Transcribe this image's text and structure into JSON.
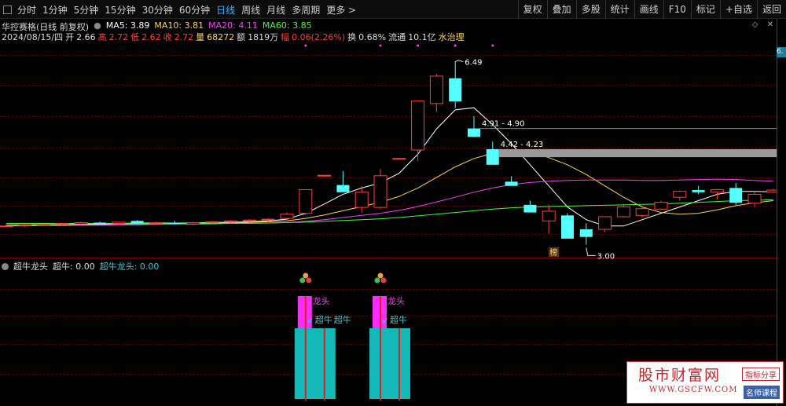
{
  "toolbar": {
    "periods": [
      "分时",
      "1分钟",
      "5分钟",
      "15分钟",
      "30分钟",
      "60分钟",
      "日线",
      "周线",
      "月线",
      "多周期",
      "更多"
    ],
    "active_period": "日线",
    "buttons": [
      "复权",
      "叠加",
      "多股",
      "统计",
      "画线",
      "F10",
      "标记",
      "+自选",
      "返回"
    ]
  },
  "stock": {
    "title": "华控赛格(日线 前复权)"
  },
  "ma": {
    "ma5": "MA5: 3.89",
    "ma10": "MA10: 3.81",
    "ma20": "MA20: 4.11",
    "ma60": "MA60: 3.85"
  },
  "quote": {
    "date": "2024/08/15/四",
    "open_label": "开",
    "open": "2.66",
    "high_label": "高",
    "high": "2.72",
    "low_label": "低",
    "low": "2.62",
    "close_label": "收",
    "close": "2.72",
    "vol_label": "量",
    "vol": "68272",
    "amount_label": "额",
    "amount": "1819万",
    "change_label": "幅",
    "change": "0.06(2.26%)",
    "turnover_label": "换",
    "turnover": "0.68%",
    "float_label": "流通",
    "float": "10.1亿",
    "concept": "水治理"
  },
  "price_tag": "6.",
  "annotations": {
    "high_label": "6.49",
    "low_label": "3.00",
    "gap1": "4.91 - 4.90",
    "gap2": "4.42 - 4.23",
    "bang": "榜"
  },
  "indicator": {
    "name": "超牛龙头",
    "value1": "超牛: 0.00",
    "value2": "超牛龙头: 0.00",
    "signal_dragon": "龙头",
    "signal_bull": "超牛",
    "signal_arrow": "↙"
  },
  "watermark": {
    "name": "股市财富网",
    "url": "WWW.GSCFW.COM",
    "badge1": "指标分享",
    "badge2": "名师课程"
  },
  "colors": {
    "up": "#ff3c3c",
    "down": "#54ffff",
    "ma5": "#ffffff",
    "ma10": "#ffd84a",
    "ma20": "#ff3cff",
    "ma60": "#3cff3c",
    "accent": "#3fb5ff"
  },
  "chart_data": {
    "type": "candlestick",
    "candles": [
      {
        "o": 2.6,
        "h": 2.64,
        "l": 2.58,
        "c": 2.6
      },
      {
        "o": 2.62,
        "h": 2.66,
        "l": 2.58,
        "c": 2.63
      },
      {
        "o": 2.63,
        "h": 2.68,
        "l": 2.6,
        "c": 2.64
      },
      {
        "o": 2.64,
        "h": 2.67,
        "l": 2.61,
        "c": 2.66
      },
      {
        "o": 2.65,
        "h": 2.7,
        "l": 2.63,
        "c": 2.68
      },
      {
        "o": 2.68,
        "h": 2.7,
        "l": 2.64,
        "c": 2.65
      },
      {
        "o": 2.66,
        "h": 2.7,
        "l": 2.63,
        "c": 2.69
      },
      {
        "o": 2.72,
        "h": 2.74,
        "l": 2.64,
        "c": 2.66
      },
      {
        "o": 2.66,
        "h": 2.7,
        "l": 2.62,
        "c": 2.68
      },
      {
        "o": 2.68,
        "h": 2.72,
        "l": 2.64,
        "c": 2.65
      },
      {
        "o": 2.65,
        "h": 2.7,
        "l": 2.62,
        "c": 2.68
      },
      {
        "o": 2.69,
        "h": 2.72,
        "l": 2.64,
        "c": 2.7
      },
      {
        "o": 2.7,
        "h": 2.74,
        "l": 2.66,
        "c": 2.72
      },
      {
        "o": 2.72,
        "h": 2.76,
        "l": 2.68,
        "c": 2.74
      },
      {
        "o": 2.75,
        "h": 2.78,
        "l": 2.7,
        "c": 2.76
      },
      {
        "o": 2.78,
        "h": 2.92,
        "l": 2.74,
        "c": 2.88
      },
      {
        "o": 2.9,
        "h": 3.46,
        "l": 2.86,
        "c": 3.46
      },
      {
        "o": 3.8,
        "h": 3.8,
        "l": 3.8,
        "c": 3.8
      },
      {
        "o": 3.57,
        "h": 3.9,
        "l": 3.4,
        "c": 3.4
      },
      {
        "o": 3.04,
        "h": 3.55,
        "l": 2.92,
        "c": 3.4
      },
      {
        "o": 3.04,
        "h": 3.95,
        "l": 3.0,
        "c": 3.79
      },
      {
        "o": 4.2,
        "h": 4.2,
        "l": 4.2,
        "c": 4.2
      },
      {
        "o": 4.4,
        "h": 5.56,
        "l": 4.14,
        "c": 5.56
      },
      {
        "o": 5.5,
        "h": 6.2,
        "l": 5.3,
        "c": 6.15
      },
      {
        "o": 6.1,
        "h": 6.49,
        "l": 5.4,
        "c": 5.55
      },
      {
        "o": 4.91,
        "h": 5.2,
        "l": 4.7,
        "c": 4.71
      },
      {
        "o": 4.42,
        "h": 4.6,
        "l": 4.05,
        "c": 4.05
      },
      {
        "o": 3.65,
        "h": 3.78,
        "l": 3.55,
        "c": 3.55
      },
      {
        "o": 3.1,
        "h": 3.2,
        "l": 2.92,
        "c": 2.92
      },
      {
        "o": 2.72,
        "h": 3.1,
        "l": 2.42,
        "c": 2.95
      },
      {
        "o": 2.85,
        "h": 2.9,
        "l": 2.3,
        "c": 2.3
      },
      {
        "o": 2.52,
        "h": 2.66,
        "l": 2.16,
        "c": 2.34
      },
      {
        "o": 2.52,
        "h": 2.82,
        "l": 2.45,
        "c": 2.82
      },
      {
        "o": 2.82,
        "h": 3.1,
        "l": 2.8,
        "c": 3.05
      },
      {
        "o": 2.85,
        "h": 3.08,
        "l": 2.8,
        "c": 3.01
      },
      {
        "o": 3.0,
        "h": 3.2,
        "l": 2.98,
        "c": 3.16
      },
      {
        "o": 3.28,
        "h": 3.44,
        "l": 3.2,
        "c": 3.42
      },
      {
        "o": 3.45,
        "h": 3.55,
        "l": 3.35,
        "c": 3.4
      },
      {
        "o": 3.4,
        "h": 3.48,
        "l": 3.22,
        "c": 3.46
      },
      {
        "o": 3.5,
        "h": 3.62,
        "l": 3.1,
        "c": 3.15
      },
      {
        "o": 3.14,
        "h": 3.4,
        "l": 3.05,
        "c": 3.35
      },
      {
        "o": 3.4,
        "h": 3.48,
        "l": 3.38,
        "c": 3.45
      }
    ],
    "ma_lines": {
      "MA5": {
        "color": "#ffffff",
        "values": [
          2.62,
          2.62,
          2.63,
          2.63,
          2.64,
          2.65,
          2.66,
          2.67,
          2.67,
          2.67,
          2.67,
          2.68,
          2.69,
          2.7,
          2.72,
          2.76,
          2.9,
          3.12,
          3.35,
          3.5,
          3.62,
          3.85,
          4.3,
          4.9,
          5.35,
          5.4,
          5.0,
          4.55,
          4.05,
          3.55,
          3.05,
          2.75,
          2.6,
          2.6,
          2.75,
          2.9,
          3.05,
          3.2,
          3.35,
          3.42,
          3.42,
          3.41
        ]
      },
      "MA10": {
        "color": "#ffd84a",
        "values": [
          2.61,
          2.61,
          2.62,
          2.62,
          2.63,
          2.63,
          2.64,
          2.65,
          2.65,
          2.66,
          2.66,
          2.67,
          2.68,
          2.69,
          2.7,
          2.72,
          2.78,
          2.86,
          2.96,
          3.06,
          3.16,
          3.3,
          3.5,
          3.75,
          4.0,
          4.2,
          4.32,
          4.38,
          4.35,
          4.22,
          4.05,
          3.82,
          3.55,
          3.28,
          3.05,
          2.92,
          2.88,
          2.9,
          2.98,
          3.08,
          3.15,
          3.2
        ]
      },
      "MA20": {
        "color": "#ff3cff",
        "values": [
          2.6,
          2.6,
          2.61,
          2.61,
          2.62,
          2.62,
          2.63,
          2.63,
          2.64,
          2.64,
          2.64,
          2.65,
          2.66,
          2.66,
          2.67,
          2.68,
          2.71,
          2.75,
          2.8,
          2.85,
          2.9,
          2.97,
          3.06,
          3.17,
          3.28,
          3.4,
          3.5,
          3.58,
          3.63,
          3.66,
          3.68,
          3.69,
          3.69,
          3.69,
          3.68,
          3.68,
          3.69,
          3.7,
          3.71,
          3.7,
          3.68,
          3.66
        ]
      },
      "MA60": {
        "color": "#3cff3c",
        "values": [
          2.66,
          2.66,
          2.66,
          2.66,
          2.66,
          2.66,
          2.66,
          2.66,
          2.66,
          2.66,
          2.66,
          2.66,
          2.67,
          2.67,
          2.67,
          2.68,
          2.69,
          2.71,
          2.73,
          2.75,
          2.77,
          2.8,
          2.84,
          2.88,
          2.92,
          2.96,
          3.0,
          3.03,
          3.05,
          3.06,
          3.07,
          3.08,
          3.09,
          3.1,
          3.11,
          3.12,
          3.14,
          3.16,
          3.18,
          3.2,
          3.21,
          3.22
        ]
      }
    },
    "high_marker": {
      "index": 24,
      "value": 6.49
    },
    "low_marker": {
      "index": 31,
      "value": 3.0
    },
    "gaps": [
      {
        "upper": 4.91,
        "lower": 4.9,
        "from_index": 25
      },
      {
        "upper": 4.42,
        "lower": 4.23,
        "from_index": 26
      }
    ],
    "signal_indices": [
      16,
      20
    ],
    "ylim": [
      2.0,
      6.8
    ]
  }
}
